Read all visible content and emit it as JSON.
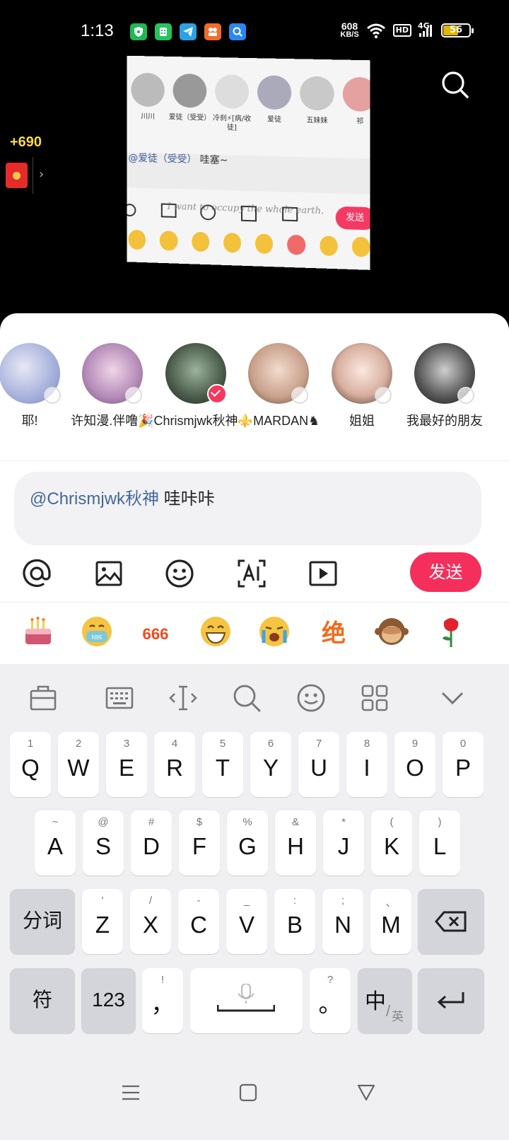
{
  "status_bar": {
    "time": "1:13",
    "net_speed_value": "608",
    "net_speed_unit": "KB/S",
    "hd_label": "HD",
    "network_label": "4G",
    "battery": "56",
    "battery_level": 0.56
  },
  "coins": {
    "amount": "+690"
  },
  "preview": {
    "users": [
      "川川",
      "爱徒（受受）",
      "冷刹⚡[病/收徒]",
      "爱徒",
      "五妹妹",
      "祁"
    ],
    "input_mention": "@爱徒（受受）",
    "input_text": "哇塞~",
    "watermark": "I want to occupy the whole earth.",
    "send_label": "发送"
  },
  "share_sheet": {
    "users": [
      {
        "name": "耶!",
        "selected": false
      },
      {
        "name": "许知漫.伴噜🎉",
        "selected": false
      },
      {
        "name": "Chrismjwk秋神",
        "selected": true
      },
      {
        "name": "⚜️MARDAN♞",
        "selected": false
      },
      {
        "name": "姐姐",
        "selected": false
      },
      {
        "name": "我最好的朋友",
        "selected": false
      }
    ],
    "comment_mention": "@Chrismjwk秋神",
    "comment_text": " 哇咔咔",
    "toolbar": {
      "icons": [
        "at-icon",
        "image-icon",
        "emoji-icon",
        "ai-icon",
        "video-icon"
      ],
      "send_label": "发送"
    },
    "emojis": [
      "cake-emoji",
      "mask-emoji",
      "666-emoji",
      "grin-emoji",
      "crying-emoji",
      "jue-emoji",
      "monkey-emoji",
      "rose-emoji"
    ],
    "emoji_jue_text": "绝",
    "emoji_666_text": "666",
    "accent": "#f42f5c",
    "mention_color": "#44679d"
  },
  "keyboard": {
    "tools": [
      "clipboard-icon",
      "keyboard-icon",
      "cursor-icon",
      "search-icon",
      "emoji-icon",
      "apps-icon",
      "chevron-down-icon"
    ],
    "row1": [
      {
        "k": "Q",
        "h": "1"
      },
      {
        "k": "W",
        "h": "2"
      },
      {
        "k": "E",
        "h": "3"
      },
      {
        "k": "R",
        "h": "4"
      },
      {
        "k": "T",
        "h": "5"
      },
      {
        "k": "Y",
        "h": "6"
      },
      {
        "k": "U",
        "h": "7"
      },
      {
        "k": "I",
        "h": "8"
      },
      {
        "k": "O",
        "h": "9"
      },
      {
        "k": "P",
        "h": "0"
      }
    ],
    "row2": [
      {
        "k": "A",
        "h": "~"
      },
      {
        "k": "S",
        "h": "@"
      },
      {
        "k": "D",
        "h": "#"
      },
      {
        "k": "F",
        "h": "$"
      },
      {
        "k": "G",
        "h": "%"
      },
      {
        "k": "H",
        "h": "&"
      },
      {
        "k": "J",
        "h": "*"
      },
      {
        "k": "K",
        "h": "("
      },
      {
        "k": "L",
        "h": ")"
      }
    ],
    "row3": [
      {
        "k": "Z",
        "h": "'"
      },
      {
        "k": "X",
        "h": "/"
      },
      {
        "k": "C",
        "h": "-"
      },
      {
        "k": "V",
        "h": "_"
      },
      {
        "k": "B",
        "h": ":"
      },
      {
        "k": "N",
        "h": ";"
      },
      {
        "k": "M",
        "h": "、"
      }
    ],
    "fenci": "分词",
    "fu": "符",
    "num": "123",
    "comma_hint": "!",
    "comma": "，",
    "period_hint": "?",
    "period": "。",
    "zh": "中",
    "en": "英"
  }
}
